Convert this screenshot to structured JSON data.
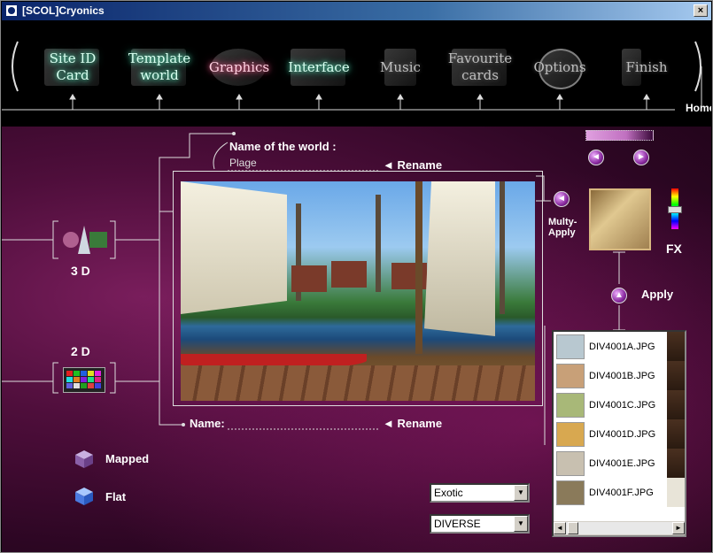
{
  "window": {
    "title": "[SCOL]Cryonics",
    "close_label": "×"
  },
  "nav": {
    "items": [
      {
        "label": "Site ID Card"
      },
      {
        "label": "Template world"
      },
      {
        "label": "Graphics"
      },
      {
        "label": "Interface"
      },
      {
        "label": "Music"
      },
      {
        "label": "Favourite cards"
      },
      {
        "label": "Options"
      },
      {
        "label": "Finish"
      }
    ],
    "home_label": "Home"
  },
  "world": {
    "name_label": "Name of the world :",
    "name_value": "Plage",
    "rename_label": "◄ Rename"
  },
  "object": {
    "name_label": "Name:",
    "rename_label": "◄ Rename"
  },
  "modes": {
    "three_d": "3 D",
    "two_d": "2 D"
  },
  "texture": {
    "multy_apply_label": "Multy-Apply",
    "apply_label": "Apply",
    "fx_label": "FX"
  },
  "files": [
    {
      "name": "DIV4001A.JPG",
      "color": "#b8c8d0"
    },
    {
      "name": "DIV4001B.JPG",
      "color": "#c8a078"
    },
    {
      "name": "DIV4001C.JPG",
      "color": "#a8b878"
    },
    {
      "name": "DIV4001D.JPG",
      "color": "#d8a850"
    },
    {
      "name": "DIV4001E.JPG",
      "color": "#c8c0b0"
    },
    {
      "name": "DIV4001F.JPG",
      "color": "#8a7a5a"
    }
  ],
  "render": {
    "mapped_label": "Mapped",
    "flat_label": "Flat"
  },
  "selects": {
    "category": "Exotic",
    "collection": "DIVERSE"
  }
}
